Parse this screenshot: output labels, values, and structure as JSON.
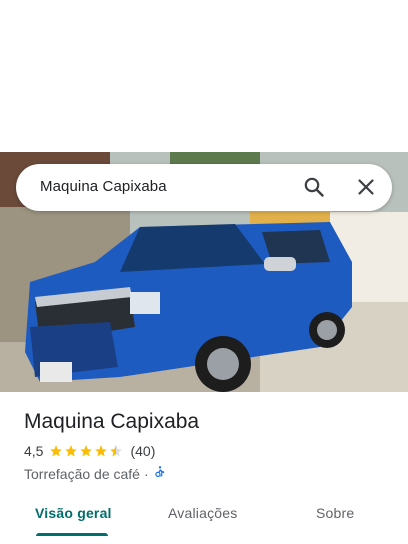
{
  "search": {
    "query": "Maquina Capixaba",
    "search_icon": "search-icon",
    "close_icon": "close-icon"
  },
  "place": {
    "name": "Maquina Capixaba",
    "rating": "4,5",
    "rating_value": 4.5,
    "rating_max": 5,
    "review_count": "(40)",
    "category": "Torrefação de café",
    "separator": "·",
    "accessibility_icon": "wheelchair-accessible-icon"
  },
  "tabs": [
    {
      "label": "Visão geral",
      "active": true
    },
    {
      "label": "Avaliações",
      "active": false
    },
    {
      "label": "Sobre",
      "active": false
    }
  ],
  "colors": {
    "accent": "#006e6a",
    "star": "#fbbc04",
    "accessible": "#1a73e8"
  }
}
